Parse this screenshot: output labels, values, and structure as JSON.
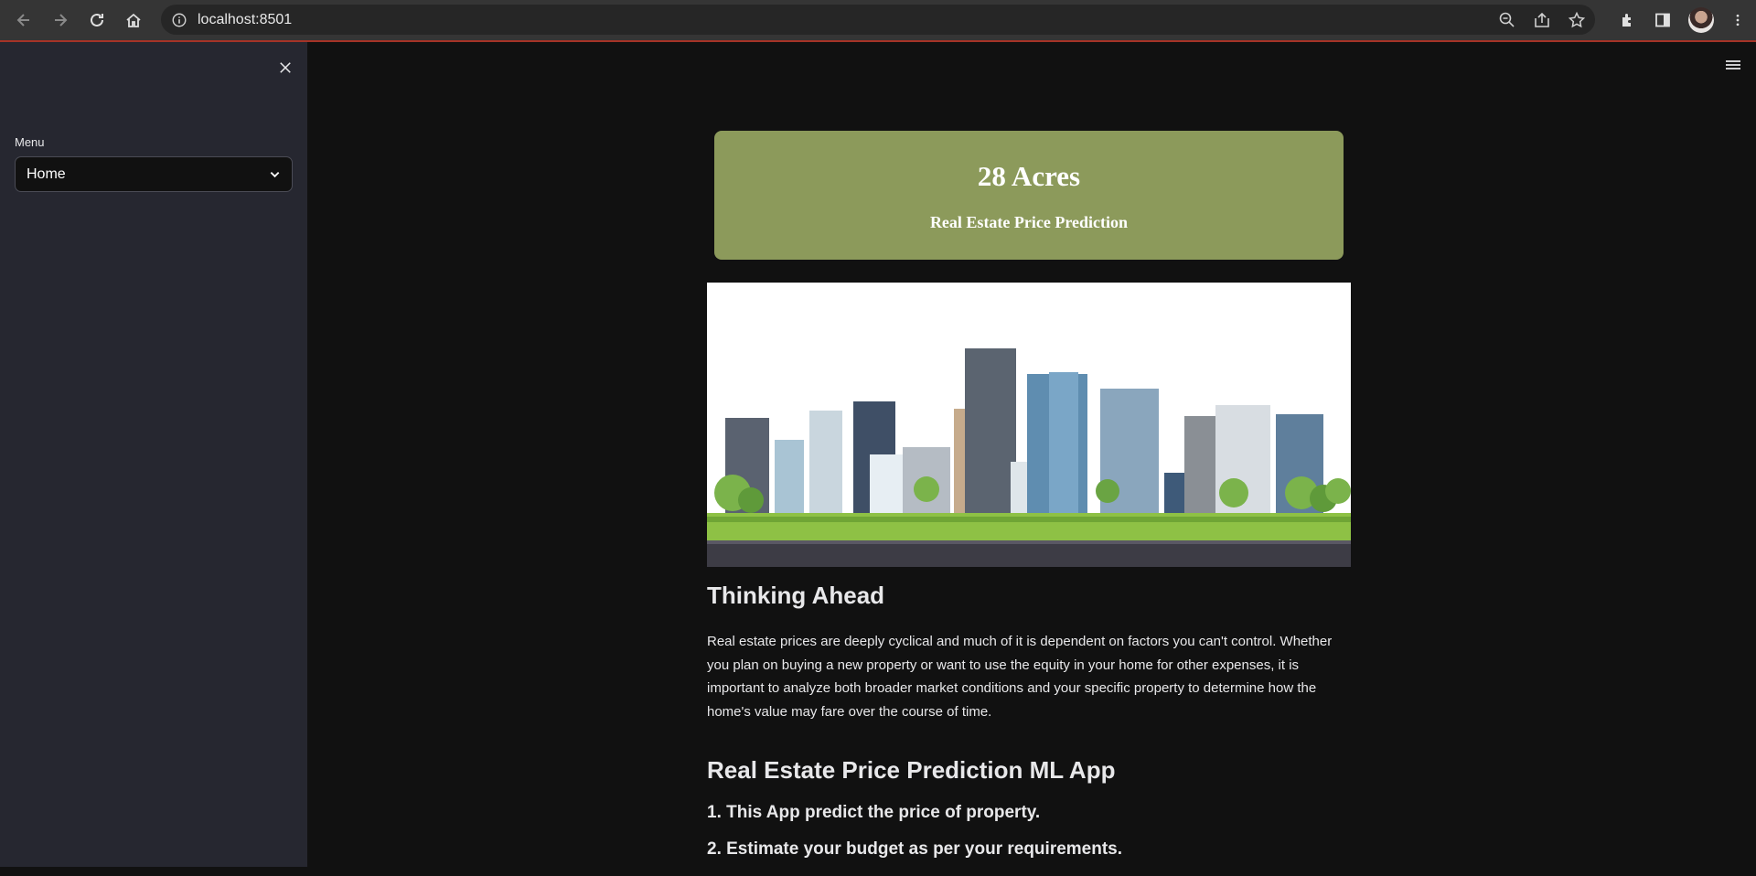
{
  "browser": {
    "url": "localhost:8501"
  },
  "sidebar": {
    "menu_label": "Menu",
    "menu_selected": "Home"
  },
  "banner": {
    "title": "28 Acres",
    "subtitle": "Real Estate Price Prediction",
    "color": "#8c9a5b"
  },
  "article": {
    "heading": "Thinking Ahead",
    "paragraph": "Real estate prices are deeply cyclical and much of it is dependent on factors you can't control. Whether you plan on buying a new property or want to use the equity in your home for other expenses, it is important to analyze both broader market conditions and your specific property to determine how the home's value may fare over the course of time.",
    "app_heading": "Real Estate Price Prediction ML App",
    "points": [
      "1. This App predict the price of property.",
      "2. Estimate your budget as per your requirements."
    ]
  },
  "colors": {
    "background": "#111111",
    "sidebar": "#262730",
    "browser_bar": "#353535"
  }
}
